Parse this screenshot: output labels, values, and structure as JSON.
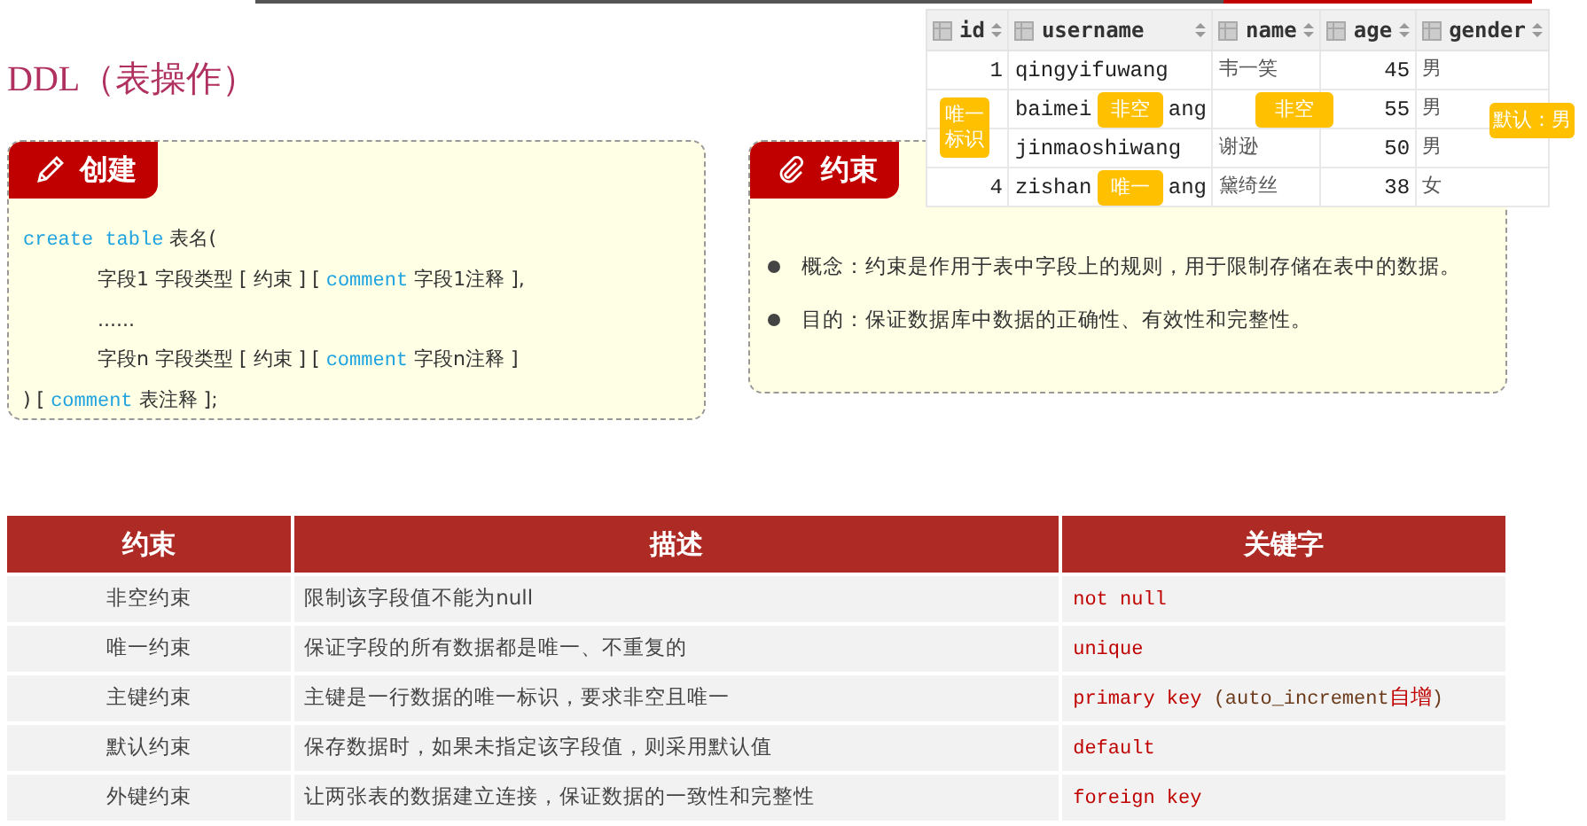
{
  "title": "DDL（表操作）",
  "create_card": {
    "label": "创建",
    "code_lines": [
      {
        "indented": false,
        "segments": [
          {
            "kind": "keyword",
            "text": "create table"
          },
          {
            "kind": "plain",
            "text": " 表名("
          }
        ]
      },
      {
        "indented": true,
        "segments": [
          {
            "kind": "plain",
            "text": "字段1 字段类型 [ 约束 ] [ "
          },
          {
            "kind": "keyword",
            "text": "comment"
          },
          {
            "kind": "plain",
            "text": " 字段1注释 ],"
          }
        ]
      },
      {
        "indented": true,
        "segments": [
          {
            "kind": "plain",
            "text": "......"
          }
        ]
      },
      {
        "indented": true,
        "segments": [
          {
            "kind": "plain",
            "text": "字段n 字段类型 [ 约束 ] [ "
          },
          {
            "kind": "keyword",
            "text": "comment"
          },
          {
            "kind": "plain",
            "text": " 字段n注释 ]"
          }
        ]
      },
      {
        "indented": false,
        "segments": [
          {
            "kind": "plain",
            "text": ") [ "
          },
          {
            "kind": "keyword",
            "text": "comment"
          },
          {
            "kind": "plain",
            "text": " 表注释 ];"
          }
        ]
      }
    ]
  },
  "constraint_card": {
    "label": "约束",
    "bullets": [
      "概念：约束是作用于表中字段上的规则，用于限制存储在表中的数据。",
      "目的：保证数据库中数据的正确性、有效性和完整性。"
    ]
  },
  "db_table": {
    "columns": [
      "id",
      "username",
      "name",
      "age",
      "gender"
    ],
    "rows": [
      [
        "1",
        "qingyifuwang",
        "韦一笑",
        "45",
        "男"
      ],
      [
        "",
        "baimei      ang",
        "",
        "55",
        "男"
      ],
      [
        "",
        "jinmaoshiwang",
        "谢逊",
        "50",
        "男"
      ],
      [
        "4",
        "zishan      ang",
        "黛绮丝",
        "38",
        "女"
      ]
    ],
    "tags": [
      "唯一标识",
      "非空",
      "非空",
      "默认：男",
      "唯一"
    ]
  },
  "constraints_table": {
    "columns": [
      "约束",
      "描述",
      "关键字"
    ],
    "rows": [
      {
        "name": "非空约束",
        "description": "限制该字段值不能为null",
        "keyword": [
          {
            "kind": "keyword",
            "text": "not  null"
          }
        ]
      },
      {
        "name": "唯一约束",
        "description": "保证字段的所有数据都是唯一、不重复的",
        "keyword": [
          {
            "kind": "keyword",
            "text": "unique"
          }
        ]
      },
      {
        "name": "主键约束",
        "description": "主键是一行数据的唯一标识，要求非空且唯一",
        "keyword": [
          {
            "kind": "keyword",
            "text": "primary  key"
          },
          {
            "kind": "plain",
            "text": " (auto_increment"
          },
          {
            "kind": "accent",
            "text": "自增"
          },
          {
            "kind": "plain",
            "text": ")"
          }
        ]
      },
      {
        "name": "默认约束",
        "description": "保存数据时，如果未指定该字段值，则采用默认值",
        "keyword": [
          {
            "kind": "keyword",
            "text": "default"
          }
        ]
      },
      {
        "name": "外键约束",
        "description": "让两张表的数据建立连接，保证数据的一致性和完整性",
        "keyword": [
          {
            "kind": "keyword",
            "text": "foreign  key"
          }
        ]
      }
    ]
  }
}
